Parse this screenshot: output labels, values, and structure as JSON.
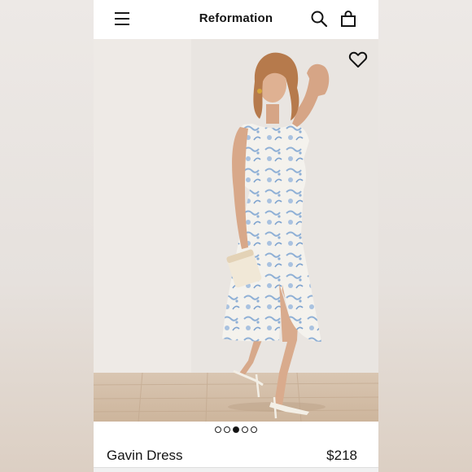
{
  "header": {
    "brand": "Reformation",
    "menu_icon": "hamburger-menu-icon",
    "search_icon": "search-icon",
    "bag_icon": "shopping-bag-icon"
  },
  "product": {
    "name": "Gavin Dress",
    "price": "$218",
    "favorite_icon": "heart-outline-icon"
  },
  "carousel": {
    "total": 5,
    "active_index": 2
  },
  "colors": {
    "text": "#141414",
    "background": "#ffffff",
    "photo_backdrop": "#ece8e4",
    "dress_print": "#8fb0d6"
  }
}
